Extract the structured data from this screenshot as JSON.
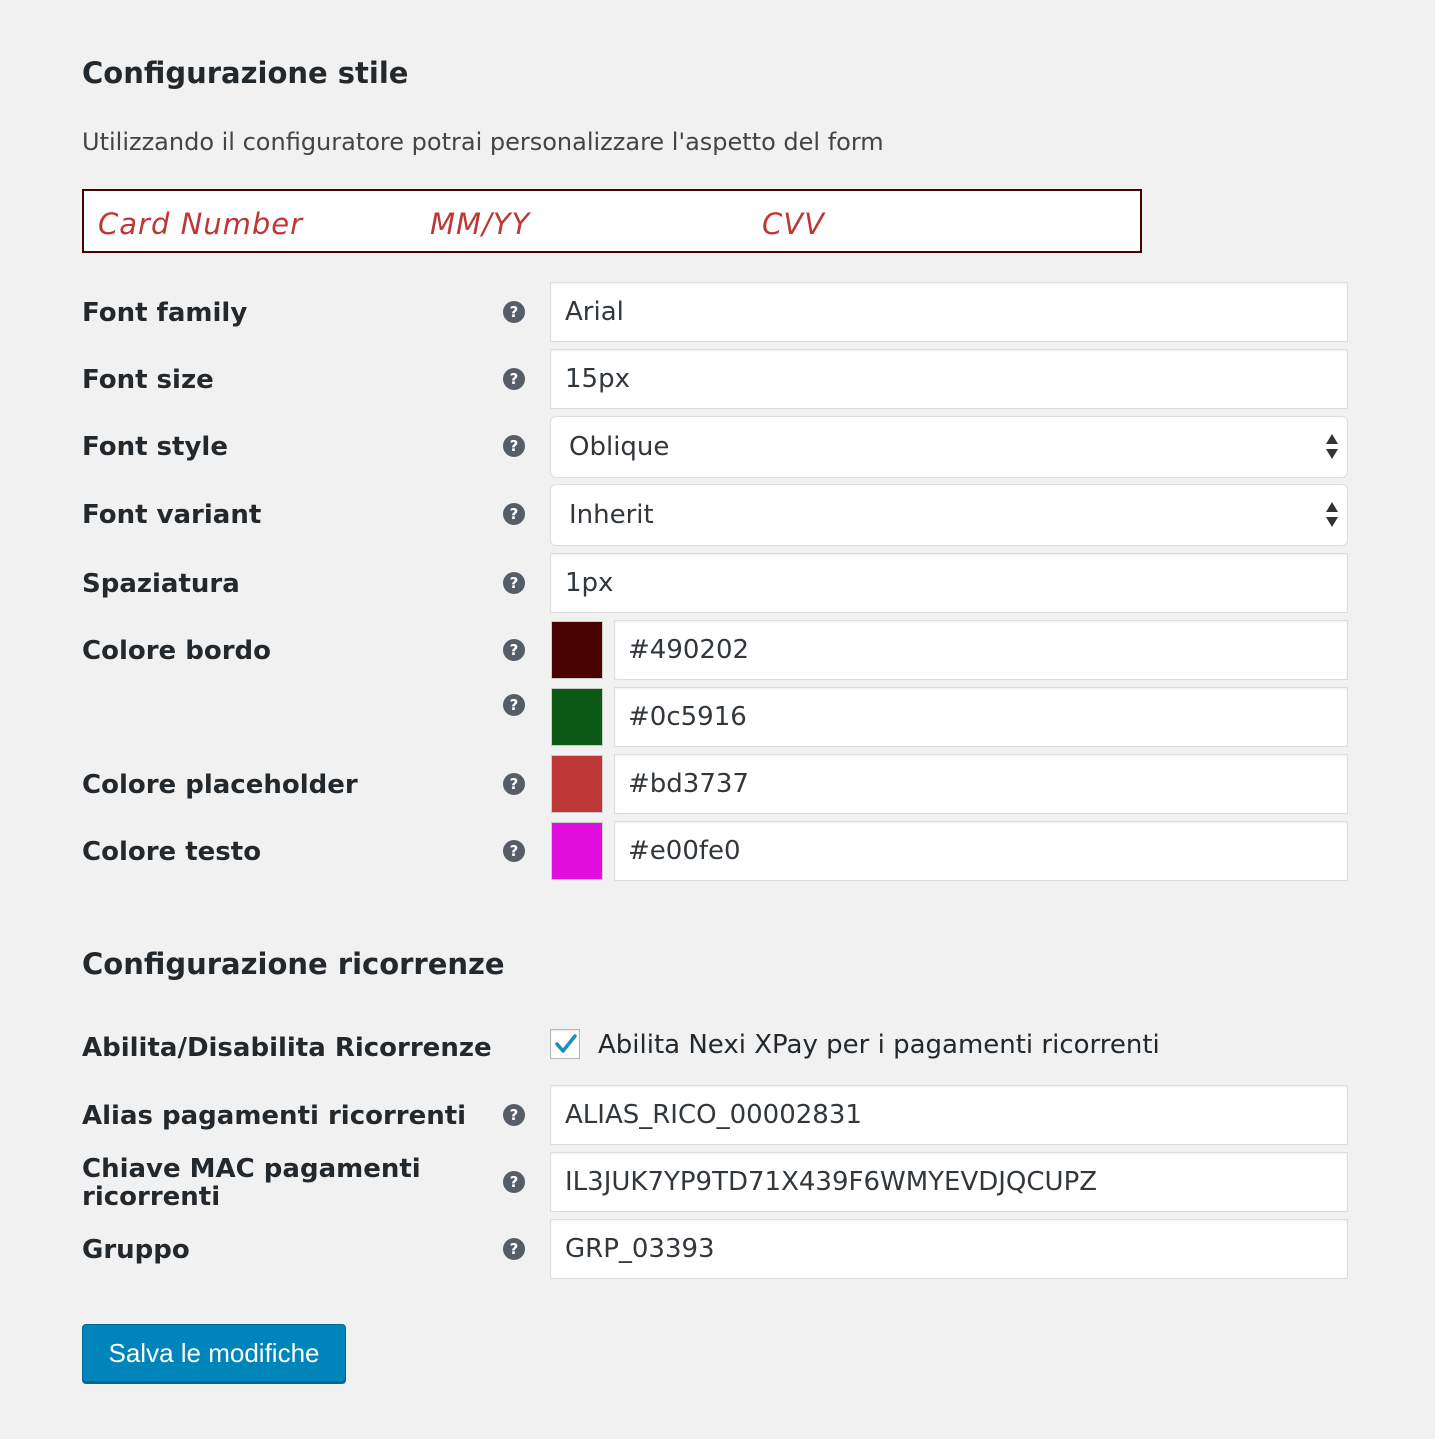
{
  "style_section": {
    "title": "Configurazione stile",
    "description": "Utilizzando il configuratore potrai personalizzare l'aspetto del form",
    "preview": {
      "card_number": "Card Number",
      "expiry": "MM/YY",
      "cvv": "CVV"
    },
    "fields": {
      "font_family": {
        "label": "Font family",
        "value": "Arial"
      },
      "font_size": {
        "label": "Font size",
        "value": "15px"
      },
      "font_style": {
        "label": "Font style",
        "value": "Oblique"
      },
      "font_variant": {
        "label": "Font variant",
        "value": "Inherit"
      },
      "spacing": {
        "label": "Spaziatura",
        "value": "1px"
      },
      "border_color": {
        "label": "Colore bordo",
        "value": "#490202"
      },
      "border_color_alt": {
        "label": "",
        "value": "#0c5916"
      },
      "placeholder_color": {
        "label": "Colore placeholder",
        "value": "#bd3737"
      },
      "text_color": {
        "label": "Colore testo",
        "value": "#e00fe0"
      }
    }
  },
  "recurring_section": {
    "title": "Configurazione ricorrenze",
    "fields": {
      "enable": {
        "label": "Abilita/Disabilita Ricorrenze",
        "checkbox_label": "Abilita Nexi XPay per i pagamenti ricorrenti",
        "checked": true
      },
      "alias": {
        "label": "Alias pagamenti ricorrenti",
        "value": "ALIAS_RICO_00002831"
      },
      "mac_key": {
        "label": "Chiave MAC pagamenti ricorrenti",
        "value": "IL3JUK7YP9TD71X439F6WMYEVDJQCUPZ"
      },
      "group": {
        "label": "Gruppo",
        "value": "GRP_03393"
      }
    }
  },
  "help_icon_glyph": "?",
  "save_button": {
    "label": "Salva le modifiche"
  },
  "colors": {
    "page_background": "#f1f1f1",
    "primary_button": "#0085ba",
    "preview_border": "#490202",
    "preview_placeholder": "#bd3737",
    "swatch_border_color": "#490202",
    "swatch_alt": "#0c5916",
    "swatch_placeholder": "#bd3737",
    "swatch_text": "#e00fe0",
    "checkmark": "#1e8cbe"
  }
}
